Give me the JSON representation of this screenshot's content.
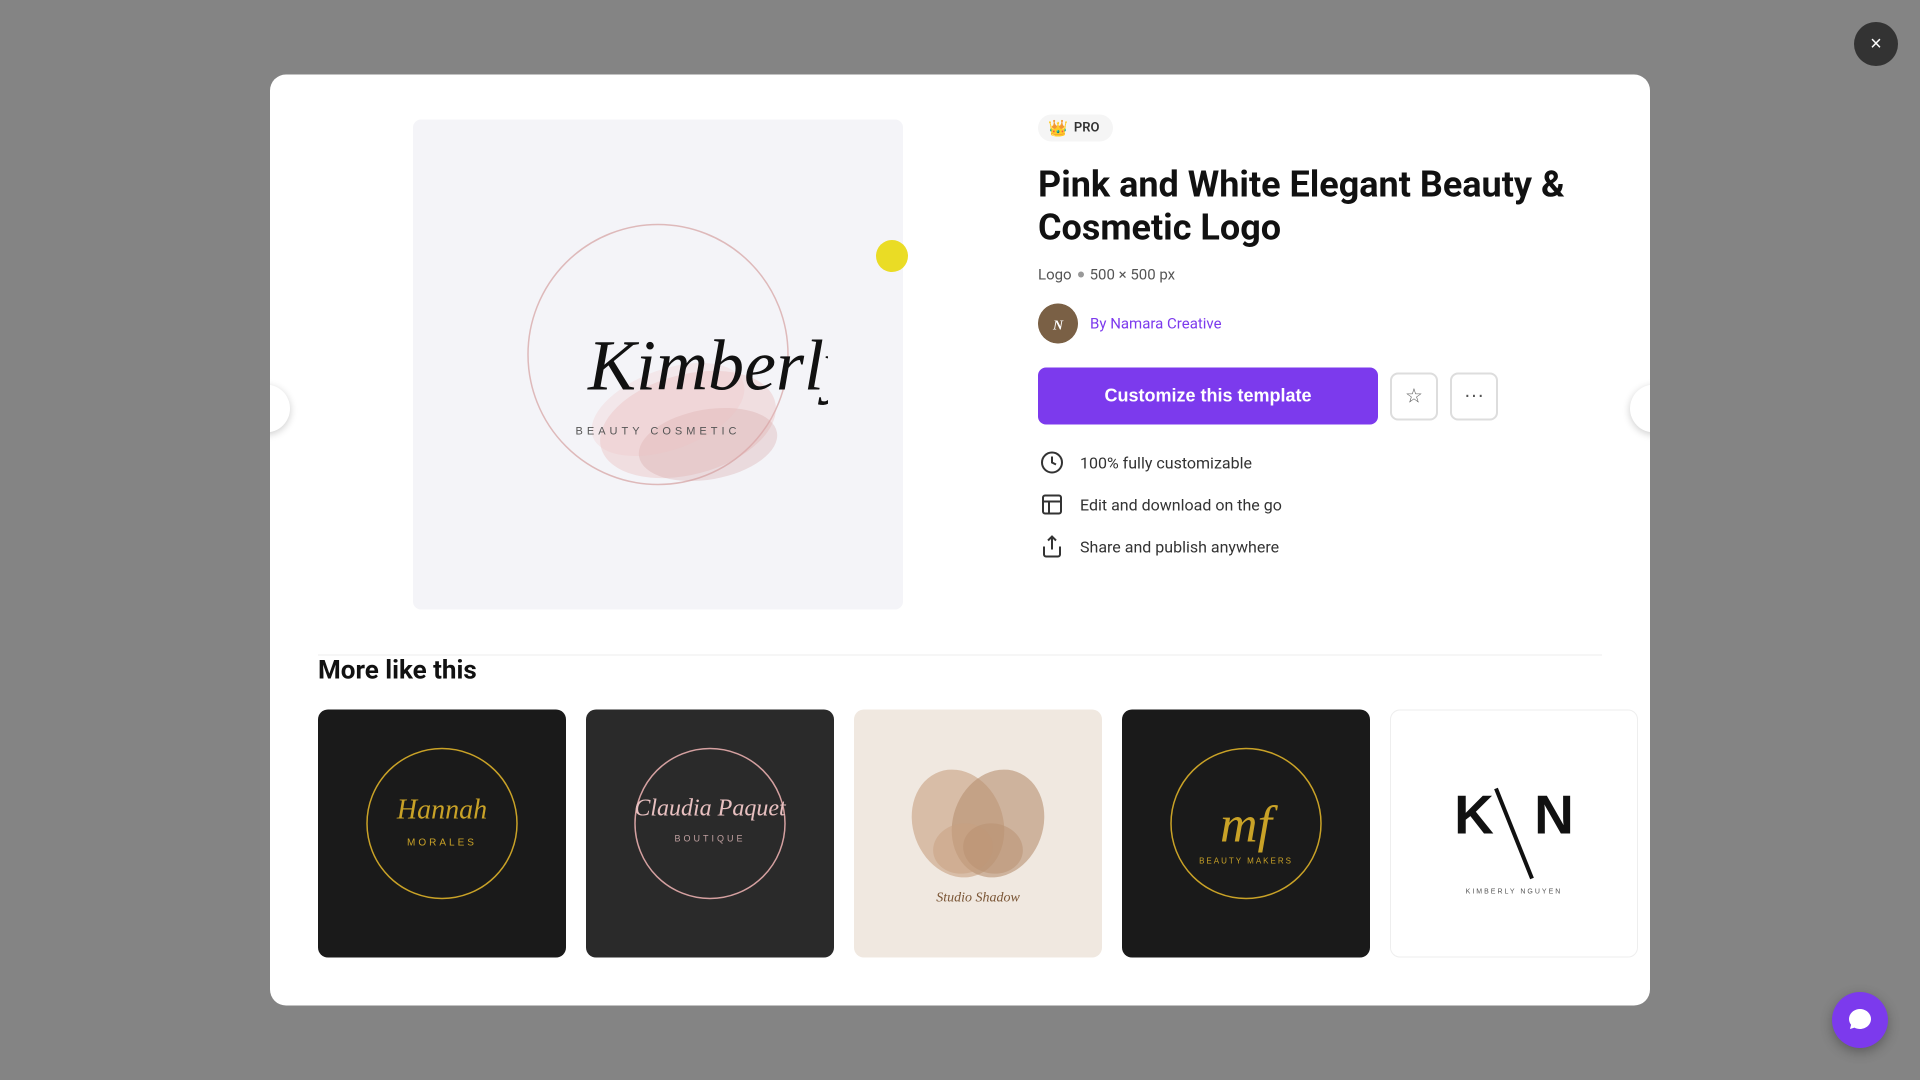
{
  "modal": {
    "close_label": "×",
    "nav_left": "‹",
    "nav_right": "›"
  },
  "pro_badge": {
    "crown": "👑",
    "label": "PRO"
  },
  "template": {
    "title": "Pink and White Elegant Beauty & Cosmetic Logo",
    "meta_type": "Logo",
    "meta_dimensions": "500 × 500 px",
    "author_prefix": "By",
    "author_name": "Namara Creative"
  },
  "actions": {
    "customize_label": "Customize this template",
    "star_icon": "☆",
    "more_icon": "···"
  },
  "features": [
    {
      "icon": "⟳",
      "text": "100% fully customizable"
    },
    {
      "icon": "▣",
      "text": "Edit and download on the go"
    },
    {
      "icon": "↑",
      "text": "Share and publish anywhere"
    }
  ],
  "more_section": {
    "title": "More like this",
    "cards": [
      {
        "id": 1,
        "style": "dark",
        "text": "Hannah\nMORALES",
        "color": "#c9a227"
      },
      {
        "id": 2,
        "style": "dark2",
        "text": "Claudia Paquet\nBOUTIQUE",
        "color": "#c9a227"
      },
      {
        "id": 3,
        "style": "light",
        "text": "Studio Shadow",
        "color": "#8b6347"
      },
      {
        "id": 4,
        "style": "dark3",
        "text": "mf\nBEAUTY MAKERS",
        "color": "#c9a227"
      },
      {
        "id": 5,
        "style": "light2",
        "text": "K/N\nKIMBERLY NGUYEN",
        "color": "#111"
      }
    ]
  },
  "chat_icon": "💬"
}
